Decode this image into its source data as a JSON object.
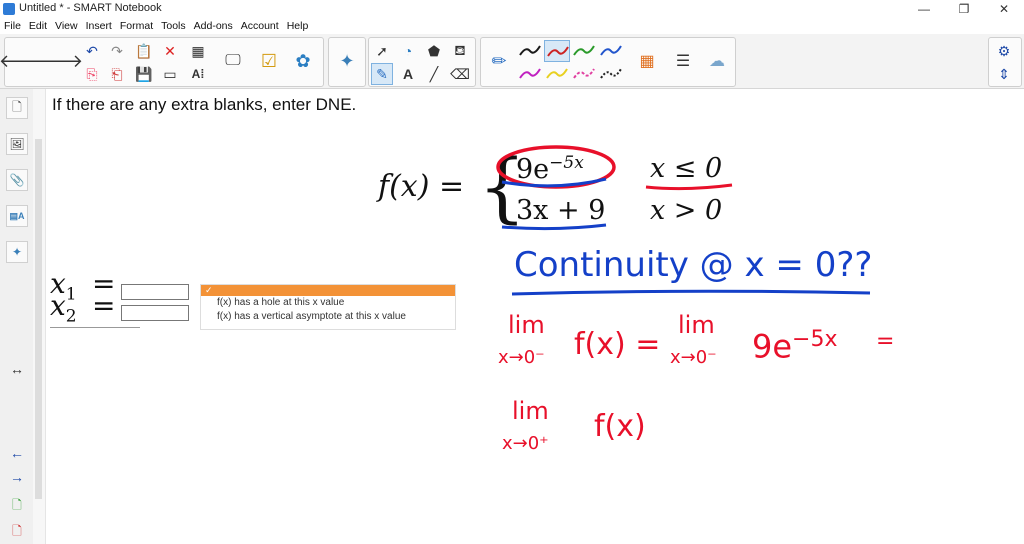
{
  "window": {
    "title": "Untitled * - SMART Notebook"
  },
  "menu": [
    "File",
    "Edit",
    "View",
    "Insert",
    "Format",
    "Tools",
    "Add-ons",
    "Account",
    "Help"
  ],
  "toolbar_icons": [
    "back-arrow",
    "forward-arrow",
    "undo",
    "redo",
    "paste",
    "delete",
    "table",
    "screen-shade",
    "document-camera",
    "activity-builder",
    "add-on",
    "select",
    "pen-shapes",
    "fill",
    "eraser-tool",
    "text",
    "line",
    "pen",
    "pen-colors",
    "color-palette",
    "properties",
    "fill-effects"
  ],
  "pen_colors": [
    "#1a1a1a",
    "#cc2222",
    "#2a9a2a",
    "#2255cc",
    "#c020c0",
    "#e8d020",
    "#e040a0",
    "#222222"
  ],
  "sidebar": {
    "icons": [
      "page-sorter",
      "gallery",
      "attachments",
      "properties",
      "addons"
    ],
    "glyphs": [
      "↔",
      "←",
      "→"
    ]
  },
  "content": {
    "instruction": "If there are any extra blanks, enter DNE.",
    "fx": "f(x) =",
    "case1_expr": "9e",
    "case1_exp": "−5x",
    "case1_cond": "x ≤ 0",
    "case2_expr": "3x + 9",
    "case2_cond": "x > 0",
    "x1_label": "x",
    "x1_sub": "1",
    "x2_label": "x",
    "x2_sub": "2",
    "eq": "="
  },
  "dropdown": {
    "selected": "✓",
    "options": [
      "f(x) has a hole at this x value",
      "f(x) has a vertical asymptote at this x value"
    ]
  },
  "handwriting": {
    "title": "Continuity @ x = 0??",
    "lim1": "lim",
    "lim1_sub": "x→0⁻",
    "lim1_rest": "f(x) =",
    "lim2": "lim",
    "lim2_sub": "x→0⁻",
    "lim2_expr": "9e",
    "lim2_exp": "−5x",
    "lim2_eq": "=",
    "lim3": "lim",
    "lim3_sub": "x→0⁺",
    "lim3_rest": "f(x)"
  },
  "colors": {
    "red_ink": "#e8102a",
    "blue_ink": "#1440c8",
    "accent": "#f39237"
  }
}
